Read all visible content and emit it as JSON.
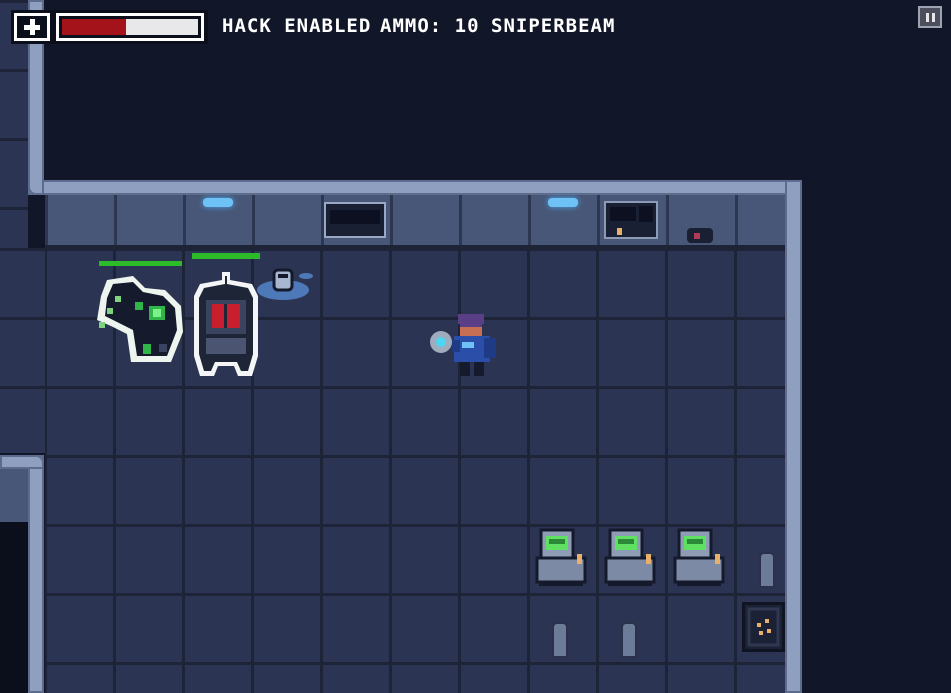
{
  "hud": {
    "health_fraction": 0.47,
    "health_fill_color": "#a5131a",
    "health_empty_color": "#e8e8ea",
    "status_text": "HACK ENABLED",
    "ammo_text": "AMMO: 10",
    "weapon_text": "SNIPERBEAM",
    "pause_icon": "pause-icon"
  },
  "enemies": [
    {
      "kind": "green-mutant",
      "health_fraction": 1.0
    },
    {
      "kind": "red-visor-robot",
      "health_fraction": 1.0
    }
  ],
  "colors": {
    "floor": "#2b3452",
    "wall": "#485777",
    "pipe": "#8e9fc0",
    "enemy_health": "#2dbb2a",
    "lamp": "#6fc2f6",
    "console_screen": "#5fe063"
  }
}
